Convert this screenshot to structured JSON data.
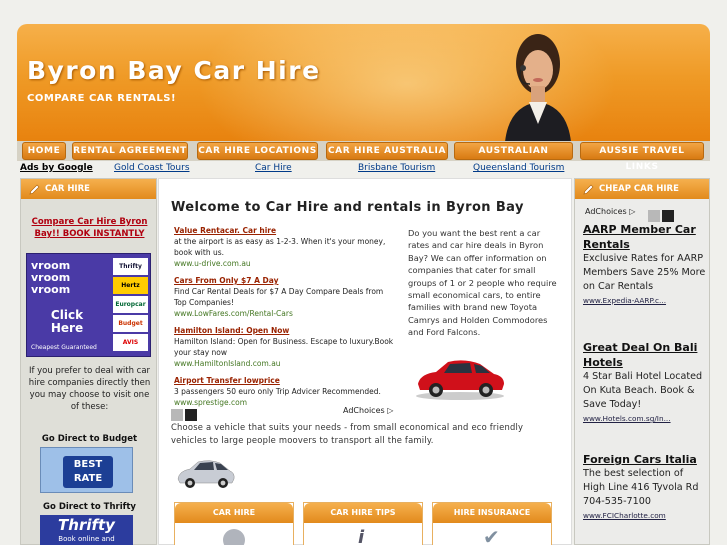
{
  "header": {
    "title": "Byron Bay Car Hire",
    "subtitle": "COMPARE CAR RENTALS!"
  },
  "nav": [
    "HOME",
    "RENTAL AGREEMENT",
    "CAR HIRE LOCATIONS",
    "CAR HIRE AUSTRALIA",
    "AUSTRALIAN HOTELS",
    "AUSSIE TRAVEL LINKS"
  ],
  "ad_row": {
    "label": "Ads by Google",
    "links": [
      "Gold Coast Tours",
      "Car Hire",
      "Brisbane Tourism",
      "Queensland Tourism"
    ]
  },
  "left_sidebar": {
    "heading": "CAR HIRE",
    "compare_link": "Compare Car Hire Byron Bay!! BOOK INSTANTLY",
    "banner": {
      "brand": "vroom vroom vroom",
      "click": "Click Here",
      "tagline": "Cheapest Guaranteed",
      "logos": [
        "Thrifty",
        "Hertz",
        "Europcar",
        "Budget",
        "AVIS"
      ]
    },
    "text": "If you prefer to deal with car hire companies directly then you may choose to visit one of these:",
    "budget_heading": "Go Direct to Budget",
    "budget_logo": "BEST RATE",
    "thrifty_heading": "Go Direct to Thrifty",
    "thrifty_logo": "Thrifty",
    "thrifty_sub": "Book online and"
  },
  "center": {
    "heading": "Welcome to Car Hire and rentals in Byron Bay",
    "ads": [
      {
        "title": "Value Rentacar. Car hire",
        "text": "at the airport is as easy as 1-2-3. When it's your money, book with us.",
        "url": "www.u-drive.com.au"
      },
      {
        "title": "Cars From Only $7 A Day",
        "text": "Find Car Rental Deals for $7 A Day Compare Deals from Top Companies!",
        "url": "www.LowFares.com/Rental-Cars"
      },
      {
        "title": "Hamilton Island: Open Now",
        "text": "Hamilton Island: Open for Business. Escape to luxury.Book your stay now",
        "url": "www.HamiltonIsland.com.au"
      },
      {
        "title": "Airport Transfer lowprice",
        "text": "3 passengers 50 euro only Trip Advicer Recommended.",
        "url": "www.sprestige.com"
      }
    ],
    "ad_choices": "AdChoices",
    "intro_text": "Do you want the best rent a car rates and car hire deals in Byron Bay? We can offer information on companies that cater for small groups of 1 or 2 people who require small economical cars, to entire families with brand new Toyota Camrys and Holden Commodores and Ford Falcons.",
    "choose_text": "Choose a vehicle that suits your needs - from small economical and eco friendly vehicles to large people moovers to transport all the family.",
    "tabs": [
      "CAR HIRE",
      "CAR HIRE TIPS",
      "HIRE INSURANCE"
    ]
  },
  "right_sidebar": {
    "heading": "CHEAP CAR HIRE",
    "ad_choices": "AdChoices",
    "ads": [
      {
        "title": "AARP Member Car Rentals",
        "text": "Exclusive Rates for AARP Members Save 25% More on Car Rentals",
        "url": "www.Expedia-AARP.c..."
      },
      {
        "title": "Great Deal On Bali Hotels",
        "text": "4 Star Bali Hotel Located On Kuta Beach. Book & Save Today!",
        "url": "www.Hotels.com.sg/In..."
      },
      {
        "title": "Foreign Cars Italia",
        "text": "The best selection of High Line 416 Tyvola Rd 704-535-7100",
        "url": "www.FCICharlotte.com"
      }
    ]
  },
  "colors": {
    "orange": "#e8820e",
    "nav_bg": "#d6d2c5",
    "link_red": "#b0000f"
  }
}
